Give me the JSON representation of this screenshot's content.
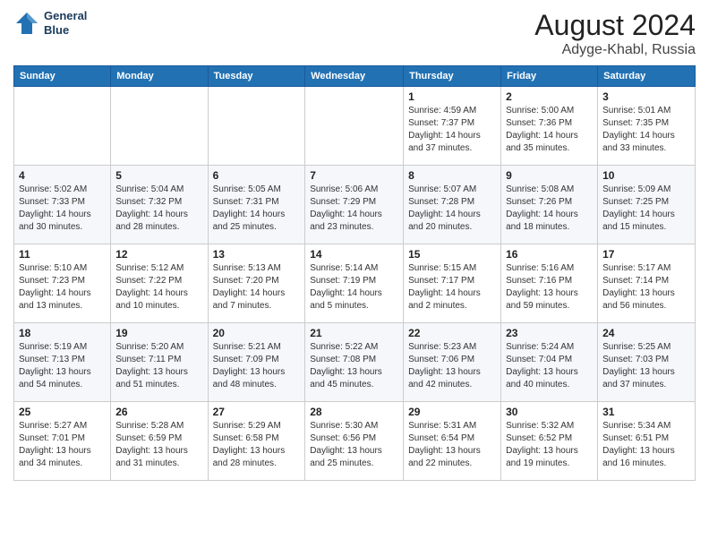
{
  "header": {
    "logo_line1": "General",
    "logo_line2": "Blue",
    "month_year": "August 2024",
    "location": "Adyge-Khabl, Russia"
  },
  "days_of_week": [
    "Sunday",
    "Monday",
    "Tuesday",
    "Wednesday",
    "Thursday",
    "Friday",
    "Saturday"
  ],
  "weeks": [
    [
      {
        "day": "",
        "info": ""
      },
      {
        "day": "",
        "info": ""
      },
      {
        "day": "",
        "info": ""
      },
      {
        "day": "",
        "info": ""
      },
      {
        "day": "1",
        "info": "Sunrise: 4:59 AM\nSunset: 7:37 PM\nDaylight: 14 hours\nand 37 minutes."
      },
      {
        "day": "2",
        "info": "Sunrise: 5:00 AM\nSunset: 7:36 PM\nDaylight: 14 hours\nand 35 minutes."
      },
      {
        "day": "3",
        "info": "Sunrise: 5:01 AM\nSunset: 7:35 PM\nDaylight: 14 hours\nand 33 minutes."
      }
    ],
    [
      {
        "day": "4",
        "info": "Sunrise: 5:02 AM\nSunset: 7:33 PM\nDaylight: 14 hours\nand 30 minutes."
      },
      {
        "day": "5",
        "info": "Sunrise: 5:04 AM\nSunset: 7:32 PM\nDaylight: 14 hours\nand 28 minutes."
      },
      {
        "day": "6",
        "info": "Sunrise: 5:05 AM\nSunset: 7:31 PM\nDaylight: 14 hours\nand 25 minutes."
      },
      {
        "day": "7",
        "info": "Sunrise: 5:06 AM\nSunset: 7:29 PM\nDaylight: 14 hours\nand 23 minutes."
      },
      {
        "day": "8",
        "info": "Sunrise: 5:07 AM\nSunset: 7:28 PM\nDaylight: 14 hours\nand 20 minutes."
      },
      {
        "day": "9",
        "info": "Sunrise: 5:08 AM\nSunset: 7:26 PM\nDaylight: 14 hours\nand 18 minutes."
      },
      {
        "day": "10",
        "info": "Sunrise: 5:09 AM\nSunset: 7:25 PM\nDaylight: 14 hours\nand 15 minutes."
      }
    ],
    [
      {
        "day": "11",
        "info": "Sunrise: 5:10 AM\nSunset: 7:23 PM\nDaylight: 14 hours\nand 13 minutes."
      },
      {
        "day": "12",
        "info": "Sunrise: 5:12 AM\nSunset: 7:22 PM\nDaylight: 14 hours\nand 10 minutes."
      },
      {
        "day": "13",
        "info": "Sunrise: 5:13 AM\nSunset: 7:20 PM\nDaylight: 14 hours\nand 7 minutes."
      },
      {
        "day": "14",
        "info": "Sunrise: 5:14 AM\nSunset: 7:19 PM\nDaylight: 14 hours\nand 5 minutes."
      },
      {
        "day": "15",
        "info": "Sunrise: 5:15 AM\nSunset: 7:17 PM\nDaylight: 14 hours\nand 2 minutes."
      },
      {
        "day": "16",
        "info": "Sunrise: 5:16 AM\nSunset: 7:16 PM\nDaylight: 13 hours\nand 59 minutes."
      },
      {
        "day": "17",
        "info": "Sunrise: 5:17 AM\nSunset: 7:14 PM\nDaylight: 13 hours\nand 56 minutes."
      }
    ],
    [
      {
        "day": "18",
        "info": "Sunrise: 5:19 AM\nSunset: 7:13 PM\nDaylight: 13 hours\nand 54 minutes."
      },
      {
        "day": "19",
        "info": "Sunrise: 5:20 AM\nSunset: 7:11 PM\nDaylight: 13 hours\nand 51 minutes."
      },
      {
        "day": "20",
        "info": "Sunrise: 5:21 AM\nSunset: 7:09 PM\nDaylight: 13 hours\nand 48 minutes."
      },
      {
        "day": "21",
        "info": "Sunrise: 5:22 AM\nSunset: 7:08 PM\nDaylight: 13 hours\nand 45 minutes."
      },
      {
        "day": "22",
        "info": "Sunrise: 5:23 AM\nSunset: 7:06 PM\nDaylight: 13 hours\nand 42 minutes."
      },
      {
        "day": "23",
        "info": "Sunrise: 5:24 AM\nSunset: 7:04 PM\nDaylight: 13 hours\nand 40 minutes."
      },
      {
        "day": "24",
        "info": "Sunrise: 5:25 AM\nSunset: 7:03 PM\nDaylight: 13 hours\nand 37 minutes."
      }
    ],
    [
      {
        "day": "25",
        "info": "Sunrise: 5:27 AM\nSunset: 7:01 PM\nDaylight: 13 hours\nand 34 minutes."
      },
      {
        "day": "26",
        "info": "Sunrise: 5:28 AM\nSunset: 6:59 PM\nDaylight: 13 hours\nand 31 minutes."
      },
      {
        "day": "27",
        "info": "Sunrise: 5:29 AM\nSunset: 6:58 PM\nDaylight: 13 hours\nand 28 minutes."
      },
      {
        "day": "28",
        "info": "Sunrise: 5:30 AM\nSunset: 6:56 PM\nDaylight: 13 hours\nand 25 minutes."
      },
      {
        "day": "29",
        "info": "Sunrise: 5:31 AM\nSunset: 6:54 PM\nDaylight: 13 hours\nand 22 minutes."
      },
      {
        "day": "30",
        "info": "Sunrise: 5:32 AM\nSunset: 6:52 PM\nDaylight: 13 hours\nand 19 minutes."
      },
      {
        "day": "31",
        "info": "Sunrise: 5:34 AM\nSunset: 6:51 PM\nDaylight: 13 hours\nand 16 minutes."
      }
    ]
  ]
}
